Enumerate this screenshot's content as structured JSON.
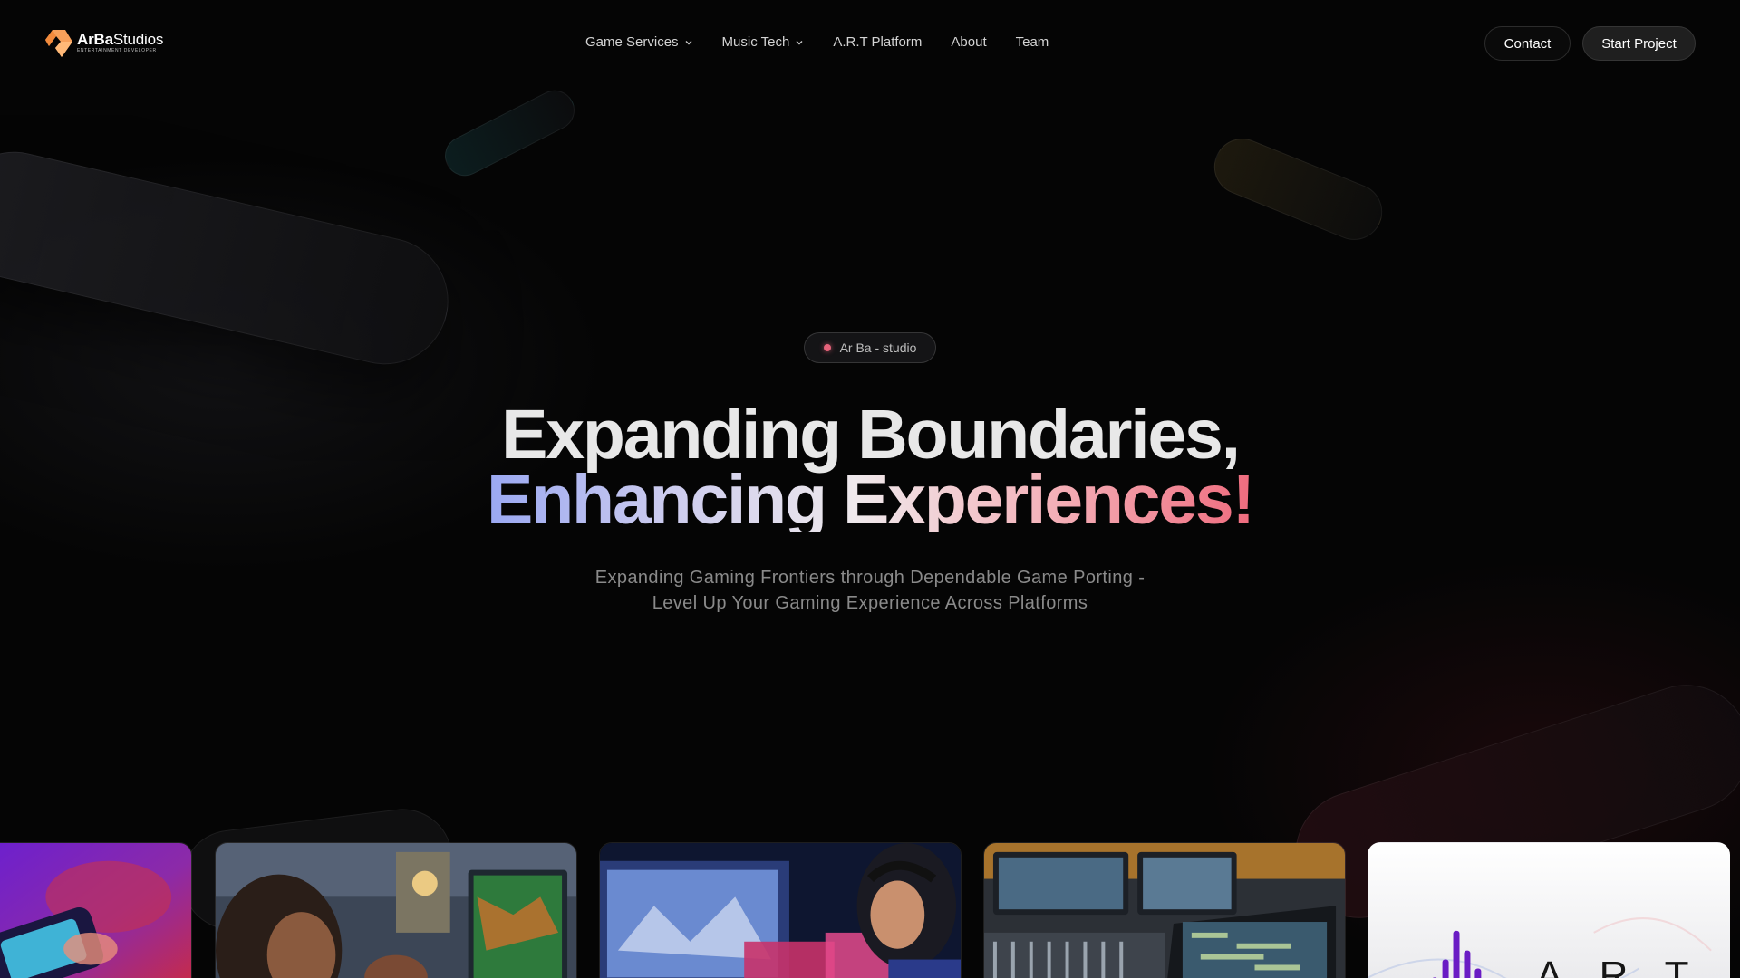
{
  "brand": {
    "name_bold": "ArBa",
    "name_light": "Studios",
    "tagline": "ENTERTAINMENT DEVELOPER",
    "logo_color": "#f7a05a"
  },
  "nav": {
    "items": [
      {
        "label": "Game Services",
        "has_dropdown": true
      },
      {
        "label": "Music Tech",
        "has_dropdown": true
      },
      {
        "label": "A.R.T Platform",
        "has_dropdown": false
      },
      {
        "label": "About",
        "has_dropdown": false
      },
      {
        "label": "Team",
        "has_dropdown": false
      }
    ]
  },
  "actions": {
    "contact_label": "Contact",
    "start_label": "Start Project"
  },
  "hero": {
    "badge": "Ar Ba - studio",
    "headline_line1": "Expanding Boundaries,",
    "headline_line2": "Enhancing Experiences!",
    "subtitle_line1": "Expanding Gaming Frontiers through Dependable Game Porting -",
    "subtitle_line2": "Level Up Your Gaming Experience Across Platforms"
  },
  "cards": {
    "art_label": "A.R.T"
  },
  "colors": {
    "background": "#050505",
    "accent_pink": "#ef6c7e",
    "accent_blue": "#9aa8f2",
    "badge_dot": "#e8637b"
  }
}
